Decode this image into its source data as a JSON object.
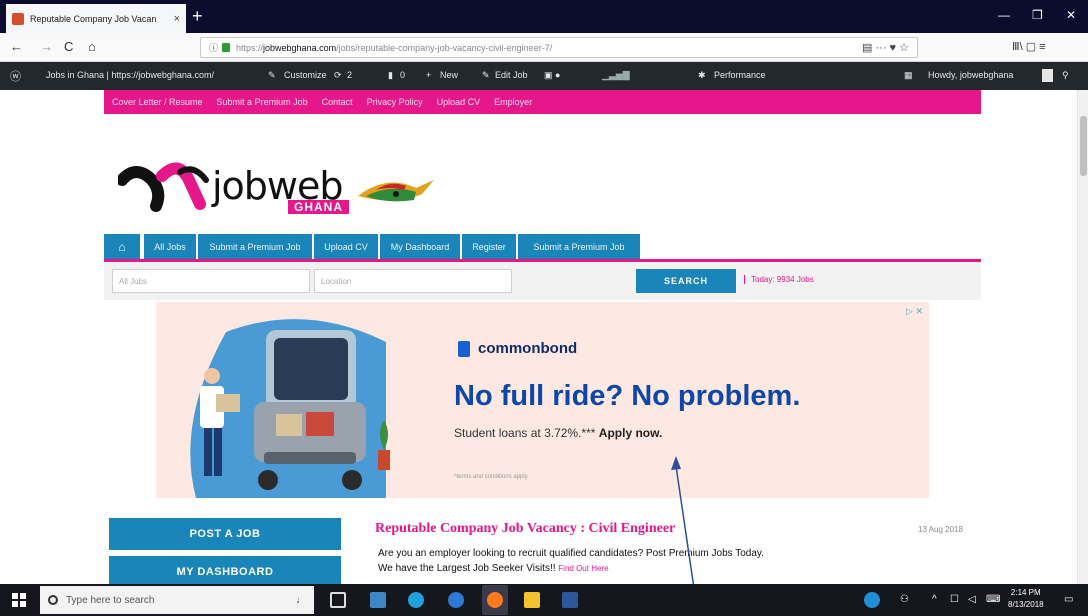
{
  "browser": {
    "tab_title": "Reputable Company Job Vacan",
    "tab_close": "×",
    "new_tab": "+",
    "win_min": "—",
    "win_max": "❐",
    "win_close": "✕",
    "back": "←",
    "forward": "→",
    "reload": "C",
    "home": "⌂",
    "url_proto": "https://",
    "url_host": "jobwebghana.com",
    "url_path": "/jobs/reputable-company-job-vacancy-civil-engineer-7/",
    "url_right_icons": "▤   ···  ♥  ☆",
    "toolbar_right_icons": "Ⅲ\\  ▢   ≡"
  },
  "wpbar": {
    "site": "Jobs in Ghana | https://jobwebghana.com/",
    "customize": "Customize",
    "updates": "2",
    "comments": "0",
    "new": "New",
    "edit_job": "Edit Job",
    "performance": "Performance",
    "howdy": "Howdy, jobwebghana"
  },
  "pink_menu": [
    "Cover Letter / Resume",
    "Submit a Premium Job",
    "Contact",
    "Privacy Policy",
    "Upload CV",
    "Employer"
  ],
  "logo": {
    "word": "jobweb",
    "tag": "GHANA"
  },
  "blue_menu": [
    "All Jobs",
    "Submit a Premium Job",
    "Upload CV",
    "My Dashboard",
    "Register",
    "Submit a Premium Job"
  ],
  "search": {
    "keywords_placeholder": "All Jobs",
    "location_placeholder": "Location",
    "button": "SEARCH",
    "today": "Today: 9934 Jobs"
  },
  "ad": {
    "choices": "▷ ✕",
    "brand": "commonbond",
    "headline": "No full ride? No problem.",
    "sub": "Student loans at 3.72%.***",
    "cta": "Apply now.",
    "fine_print": "*terms and conditions apply"
  },
  "sidebar": {
    "post_job": "POST A JOB",
    "dashboard": "MY DASHBOARD"
  },
  "post": {
    "title": "Reputable Company Job Vacancy : Civil Engineer",
    "date": "13 Aug 2018",
    "line1": "Are you an employer looking to recruit qualified candidates? Post Premium Jobs Today.",
    "line2": "We have the Largest Job Seeker Visits!!",
    "line2_link": "Find Out Here"
  },
  "taskbar": {
    "search_text": "Type here to search",
    "clock_time": "2:14 PM",
    "clock_date": "8/13/2018"
  },
  "colors": {
    "brand_pink": "#e5178a",
    "brand_blue": "#1a85b8",
    "ad_headline": "#0f47a8"
  }
}
